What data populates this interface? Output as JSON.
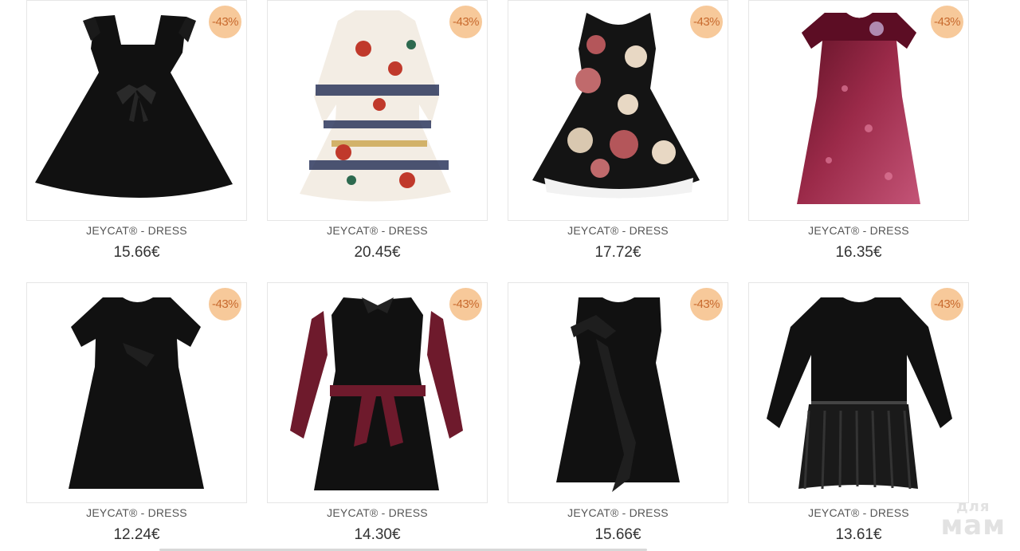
{
  "products": [
    {
      "name": "JEYCAT® - DRESS",
      "price": "15.66€",
      "discount": "-43%",
      "image": "black-sleeveless-bow-dress"
    },
    {
      "name": "JEYCAT® - DRESS",
      "price": "20.45€",
      "discount": "-43%",
      "image": "floral-print-long-sleeve-dress"
    },
    {
      "name": "JEYCAT® - DRESS",
      "price": "17.72€",
      "discount": "-43%",
      "image": "black-floral-sleeveless-dress"
    },
    {
      "name": "JEYCAT® - DRESS",
      "price": "16.35€",
      "discount": "-43%",
      "image": "burgundy-sequin-dress"
    },
    {
      "name": "JEYCAT® - DRESS",
      "price": "12.24€",
      "discount": "-43%",
      "image": "black-short-sleeve-dress"
    },
    {
      "name": "JEYCAT® - DRESS",
      "price": "14.30€",
      "discount": "-43%",
      "image": "black-pinafore-check-sleeve-dress"
    },
    {
      "name": "JEYCAT® - DRESS",
      "price": "15.66€",
      "discount": "-43%",
      "image": "black-ruffle-sleeveless-dress"
    },
    {
      "name": "JEYCAT® - DRESS",
      "price": "13.61€",
      "discount": "-43%",
      "image": "black-fur-skirt-sweater-dress"
    }
  ],
  "watermark": {
    "line1": "для",
    "line2": "мам"
  },
  "colors": {
    "badge_bg": "#f7c99a",
    "badge_text": "#c86a2e",
    "burgundy": "#7a1530",
    "dress_black": "#111111"
  }
}
